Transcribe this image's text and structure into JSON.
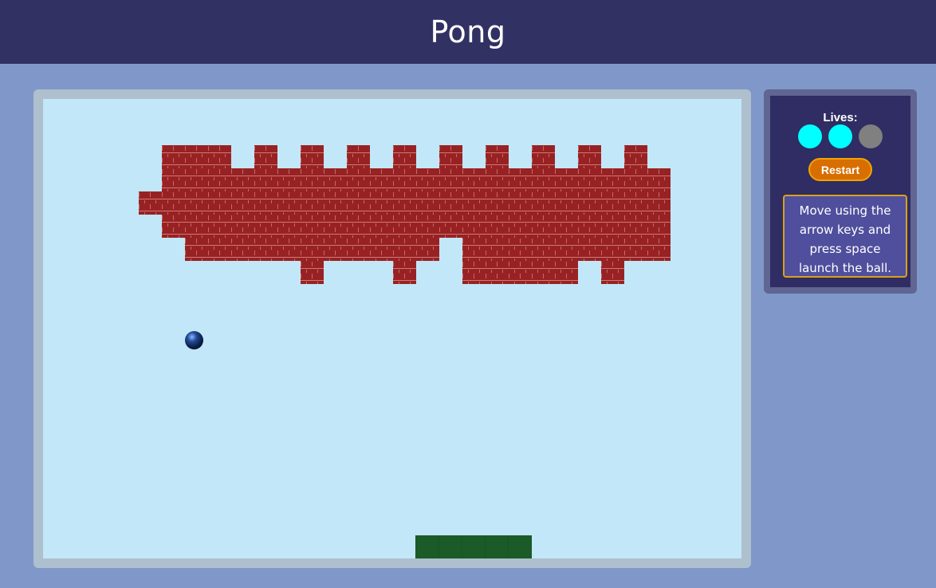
{
  "header": {
    "title": "Pong"
  },
  "game": {
    "bricks": {
      "rows": [
        [
          5,
          6,
          7,
          9,
          11,
          13,
          15,
          17,
          19,
          21,
          23,
          25
        ],
        [
          5,
          6,
          7,
          9,
          11,
          13,
          15,
          17,
          19,
          21,
          23,
          25
        ],
        [
          5,
          6,
          7,
          8,
          9,
          10,
          11,
          12,
          13,
          14,
          15,
          16,
          17,
          18,
          19,
          20,
          21,
          22,
          23,
          24,
          25,
          26
        ],
        [
          5,
          6,
          7,
          8,
          9,
          10,
          11,
          12,
          13,
          14,
          15,
          16,
          17,
          18,
          19,
          20,
          21,
          22,
          23,
          24,
          25,
          26
        ],
        [
          4,
          5,
          6,
          7,
          8,
          9,
          10,
          11,
          12,
          13,
          14,
          15,
          16,
          17,
          18,
          19,
          20,
          21,
          22,
          23,
          24,
          25,
          26
        ],
        [
          4,
          5,
          6,
          7,
          8,
          9,
          10,
          11,
          12,
          13,
          14,
          15,
          16,
          17,
          18,
          19,
          20,
          21,
          22,
          23,
          24,
          25,
          26
        ],
        [
          5,
          6,
          7,
          8,
          9,
          10,
          11,
          12,
          13,
          14,
          15,
          16,
          17,
          18,
          19,
          20,
          21,
          22,
          23,
          24,
          25,
          26
        ],
        [
          5,
          6,
          7,
          8,
          9,
          10,
          11,
          12,
          13,
          14,
          15,
          16,
          17,
          18,
          19,
          20,
          21,
          22,
          23,
          24,
          25,
          26
        ],
        [
          6,
          7,
          8,
          9,
          10,
          11,
          12,
          13,
          14,
          15,
          16,
          18,
          19,
          20,
          21,
          22,
          23,
          24,
          25,
          26
        ],
        [
          6,
          7,
          8,
          9,
          10,
          11,
          12,
          13,
          14,
          15,
          16,
          18,
          19,
          20,
          21,
          22,
          23,
          24,
          25,
          26
        ],
        [
          11,
          15,
          18,
          19,
          20,
          21,
          22,
          24
        ],
        [
          11,
          15,
          18,
          19,
          20,
          21,
          22,
          24
        ]
      ]
    }
  },
  "sidebar": {
    "lives_label": "Lives:",
    "lives": {
      "remaining": 2,
      "total": 3
    },
    "restart_label": "Restart",
    "instructions": "Move using the arrow keys and press space launch the ball."
  },
  "colors": {
    "background": "#7f98c9",
    "header": "#323163",
    "board": "#c2e7f8",
    "brick": "#982223",
    "paddle": "#1b5b27",
    "life_full": "#00ffff",
    "life_empty": "#808080",
    "restart_button": "#d86e00"
  }
}
